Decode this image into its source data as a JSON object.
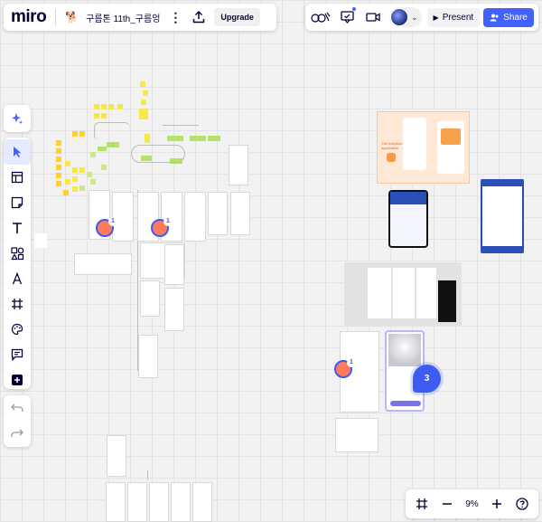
{
  "header": {
    "logo": "miro",
    "board_emoji": "🐕",
    "board_name": "구름톤 11th_구름엉",
    "upgrade_label": "Upgrade"
  },
  "topbar": {
    "present_label": "Present",
    "share_label": "Share"
  },
  "toolbar": {
    "tools": [
      "ai-assist",
      "select",
      "templates",
      "sticky-note",
      "text",
      "shapes",
      "pen",
      "frame",
      "stickers",
      "comment",
      "more"
    ]
  },
  "zoom": {
    "level": "9%"
  },
  "canvas": {
    "collaborator_count": "3",
    "cursor_badges": [
      "1",
      "1",
      "1"
    ],
    "card_texts": {
      "app_title": "The Adoption application"
    }
  },
  "colors": {
    "accent": "#4262ff",
    "badge": "#3c5cf4",
    "sticky_yellow": "#f5e84a",
    "sticky_orange": "#ffd02f",
    "sticky_green": "#cde88a",
    "app_orange": "#ffe8d6"
  }
}
